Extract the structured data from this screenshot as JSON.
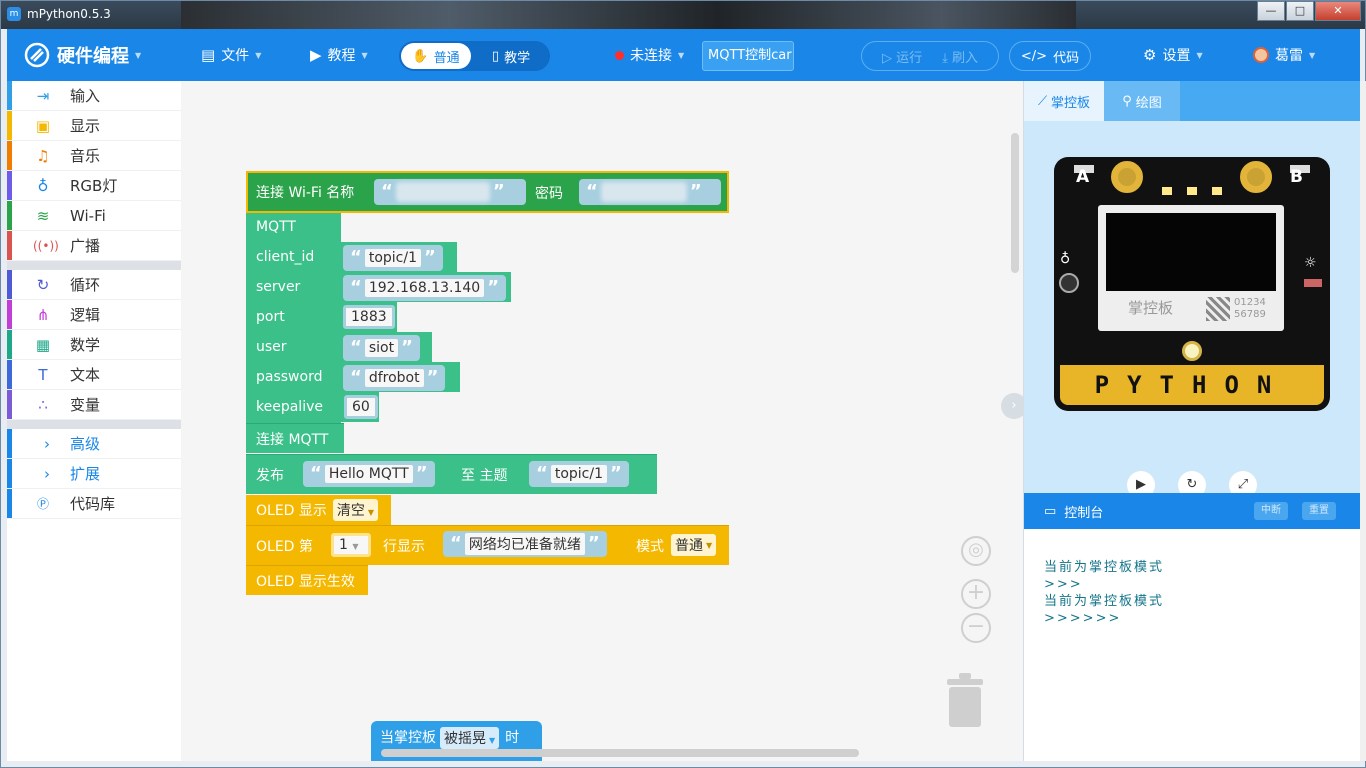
{
  "window": {
    "title": "mPython0.5.3",
    "min": "—",
    "max": "□",
    "close": "✕"
  },
  "toolbar": {
    "brand": "硬件编程",
    "file": "文件",
    "tutorial": "教程",
    "mode_normal": "普通",
    "mode_teach": "教学",
    "connection": "未连接",
    "project": "MQTT控制car",
    "run": "运行",
    "flash": "刷入",
    "code": "代码",
    "settings": "设置",
    "user": "葛雷"
  },
  "sidebar": {
    "items": [
      {
        "label": "输入",
        "color": "#2f9fe8"
      },
      {
        "label": "显示",
        "color": "#f5b800"
      },
      {
        "label": "音乐",
        "color": "#f07c00"
      },
      {
        "label": "RGB灯",
        "color": "#6c5ce7"
      },
      {
        "label": "Wi-Fi",
        "color": "#2aa34a"
      },
      {
        "label": "广播",
        "color": "#d9534f"
      },
      {
        "label": "循环",
        "color": "#4f5bd5"
      },
      {
        "label": "逻辑",
        "color": "#c13fd6"
      },
      {
        "label": "数学",
        "color": "#1ea88a"
      },
      {
        "label": "文本",
        "color": "#3d6ad8"
      },
      {
        "label": "变量",
        "color": "#7b5cd6"
      },
      {
        "label": "高级",
        "color": "#1a87e8"
      },
      {
        "label": "扩展",
        "color": "#1a87e8"
      },
      {
        "label": "代码库",
        "color": "#1a87e8"
      }
    ]
  },
  "blocks": {
    "wifi_connect": "连接 Wi-Fi 名称",
    "wifi_password": "密码",
    "mqtt": "MQTT",
    "client_id_label": "client_id",
    "client_id": "topic/1",
    "server_label": "server",
    "server": "192.168.13.140",
    "port_label": "port",
    "port": "1883",
    "user_label": "user",
    "user": "siot",
    "password_label": "password",
    "password": "dfrobot",
    "keepalive_label": "keepalive",
    "keepalive": "60",
    "connect_mqtt": "连接 MQTT",
    "publish": "发布",
    "publish_msg": "Hello MQTT",
    "to_topic": "至 主题",
    "publish_topic": "topic/1",
    "oled_show": "OLED 显示",
    "oled_clear": "清空",
    "oled_line": "OLED 第",
    "line_no": "1",
    "line_show": "行显示",
    "line_text": "网络均已准备就绪",
    "mode": "模式",
    "mode_value": "普通",
    "oled_apply": "OLED 显示生效",
    "event_when": "当掌控板",
    "event_action": "被摇晃",
    "event_time": "时",
    "quote_open": "“",
    "quote_close": "”"
  },
  "right": {
    "tab_board": "掌控板",
    "tab_draw": "绘图",
    "board_a": "A",
    "board_b": "B",
    "board_name": "掌控板",
    "board_code": "01234 56789",
    "board_logo": "PYTHON",
    "console_title": "控制台",
    "interrupt": "中断",
    "reset": "重置",
    "console_lines": [
      "当前为掌控板模式",
      ">>>",
      "当前为掌控板模式",
      ">>>>>>"
    ]
  }
}
